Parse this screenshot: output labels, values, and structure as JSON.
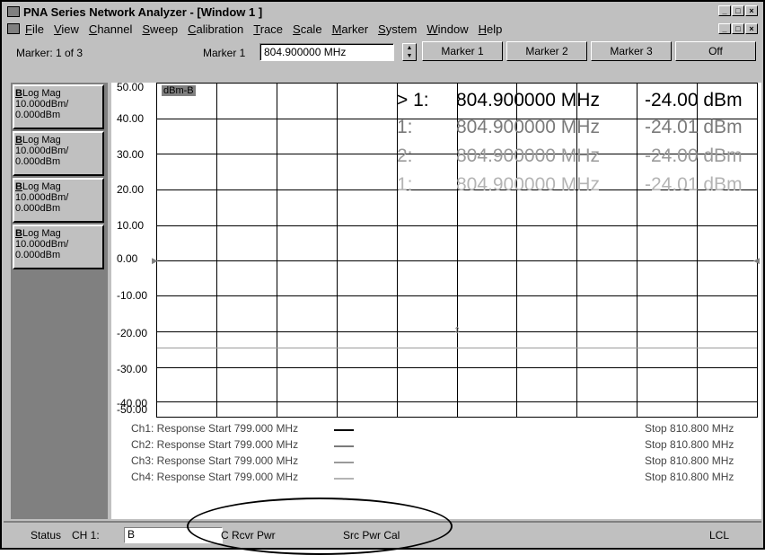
{
  "window": {
    "title": "PNA Series Network Analyzer - [Window 1 ]",
    "controls": [
      "_",
      "□",
      "×"
    ]
  },
  "menu": [
    "File",
    "View",
    "Channel",
    "Sweep",
    "Calibration",
    "Trace",
    "Scale",
    "Marker",
    "System",
    "Window",
    "Help"
  ],
  "toolbar": {
    "marker_count": "Marker: 1 of 3",
    "marker_label": "Marker 1",
    "marker_value": "804.900000 MHz",
    "buttons": [
      "Marker 1",
      "Marker 2",
      "Marker 3",
      "Off"
    ]
  },
  "traces": [
    {
      "prefix": "B",
      "line1": "Log Mag",
      "line2": "10.000dBm/",
      "line3": "0.000dBm"
    },
    {
      "prefix": "B",
      "line1": "Log Mag",
      "line2": "10.000dBm/",
      "line3": "0.000dBm"
    },
    {
      "prefix": "B",
      "line1": "Log Mag",
      "line2": "10.000dBm/",
      "line3": "0.000dBm"
    },
    {
      "prefix": "B",
      "line1": "Log Mag",
      "line2": "10.000dBm/",
      "line3": "0.000dBm"
    }
  ],
  "plot": {
    "unit_badge": "dBm-B",
    "y_ticks": [
      "50.00",
      "40.00",
      "30.00",
      "20.00",
      "10.00",
      "0.00",
      "-10.00",
      "-20.00",
      "-30.00",
      "-40.00",
      "-50.00"
    ],
    "marker_readouts": [
      {
        "idx": "> 1:",
        "freq": "804.900000 MHz",
        "level": "-24.00 dBm",
        "color": "#000000"
      },
      {
        "idx": "1:",
        "freq": "804.900000 MHz",
        "level": "-24.01 dBm",
        "color": "#7a7a7a"
      },
      {
        "idx": "2:",
        "freq": "804.900000 MHz",
        "level": "-24.00 dBm",
        "color": "#9a9a9a"
      },
      {
        "idx": "1:",
        "freq": "804.900000 MHz",
        "level": "-24.01 dBm",
        "color": "#b4b4b4"
      }
    ],
    "channels": [
      {
        "start": "Ch1: Response Start  799.000 MHz",
        "stop": "Stop  810.800 MHz"
      },
      {
        "start": "Ch2: Response Start  799.000 MHz",
        "stop": "Stop  810.800 MHz"
      },
      {
        "start": "Ch3: Response Start  799.000 MHz",
        "stop": "Stop  810.800 MHz"
      },
      {
        "start": "Ch4: Response Start  799.000 MHz",
        "stop": "Stop  810.800 MHz"
      }
    ]
  },
  "status": {
    "label": "Status",
    "channel": "CH 1:",
    "field": "B",
    "item1": "C  Rcvr Pwr",
    "item2": "Src Pwr Cal",
    "item3": "LCL"
  }
}
